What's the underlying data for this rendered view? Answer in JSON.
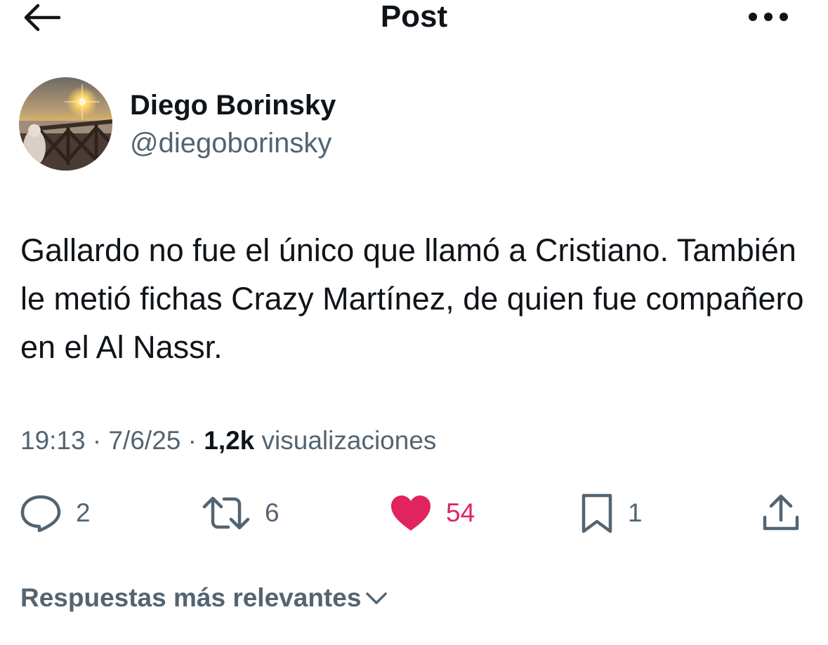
{
  "header": {
    "title": "Post",
    "back_icon": "arrow-left-icon",
    "more_icon": "more-horizontal-icon"
  },
  "author": {
    "name": "Diego Borinsky",
    "handle": "@diegoborinsky",
    "avatar_icon": "sunset-avatar"
  },
  "post": {
    "text": "Gallardo no fue el único que llamó a Cristiano. También le metió fichas Crazy Martínez, de quien fue compañero en el Al Nassr."
  },
  "meta": {
    "time": "19:13",
    "separator": "·",
    "date": "7/6/25",
    "views_count": "1,2k",
    "views_label": "visualizaciones"
  },
  "actions": {
    "replies": "2",
    "reposts": "6",
    "likes": "54",
    "bookmarks": "1"
  },
  "replies_sort": {
    "label": "Respuestas más relevantes"
  },
  "colors": {
    "text": "#0f1419",
    "secondary": "#536471",
    "like": "#e0245e"
  }
}
